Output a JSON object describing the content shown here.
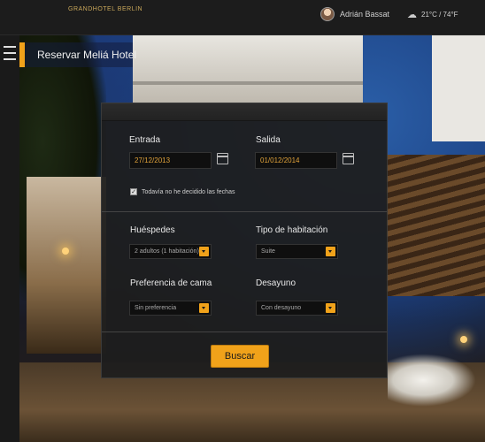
{
  "header": {
    "brand": "GRANDHOTEL BERLIN",
    "user_name": "Adrián Bassat",
    "weather": "21°C / 74°F",
    "weather_icon": "cloud-rain-icon"
  },
  "sidebar": {
    "menu_icon": "hamburger-menu-icon",
    "section_title": "Reservar Meliá Hotel"
  },
  "booking": {
    "checkin_label": "Entrada",
    "checkin_value": "27/12/2013",
    "checkout_label": "Salida",
    "checkout_value": "01/012/2014",
    "undecided_label": "Todavía no he decidido las fechas",
    "undecided_checked": true,
    "guests_label": "Huéspedes",
    "guests_value": "2 adultos (1 habitación)",
    "room_type_label": "Tipo de habitación",
    "room_type_value": "Suite",
    "bed_pref_label": "Preferencia de cama",
    "bed_pref_value": "Sin preferencia",
    "breakfast_label": "Desayuno",
    "breakfast_value": "Con desayuno",
    "search_label": "Buscar"
  },
  "colors": {
    "accent": "#f0a21a",
    "brand_gold": "#c9a75a",
    "panel_bg": "#1e1e1e"
  }
}
